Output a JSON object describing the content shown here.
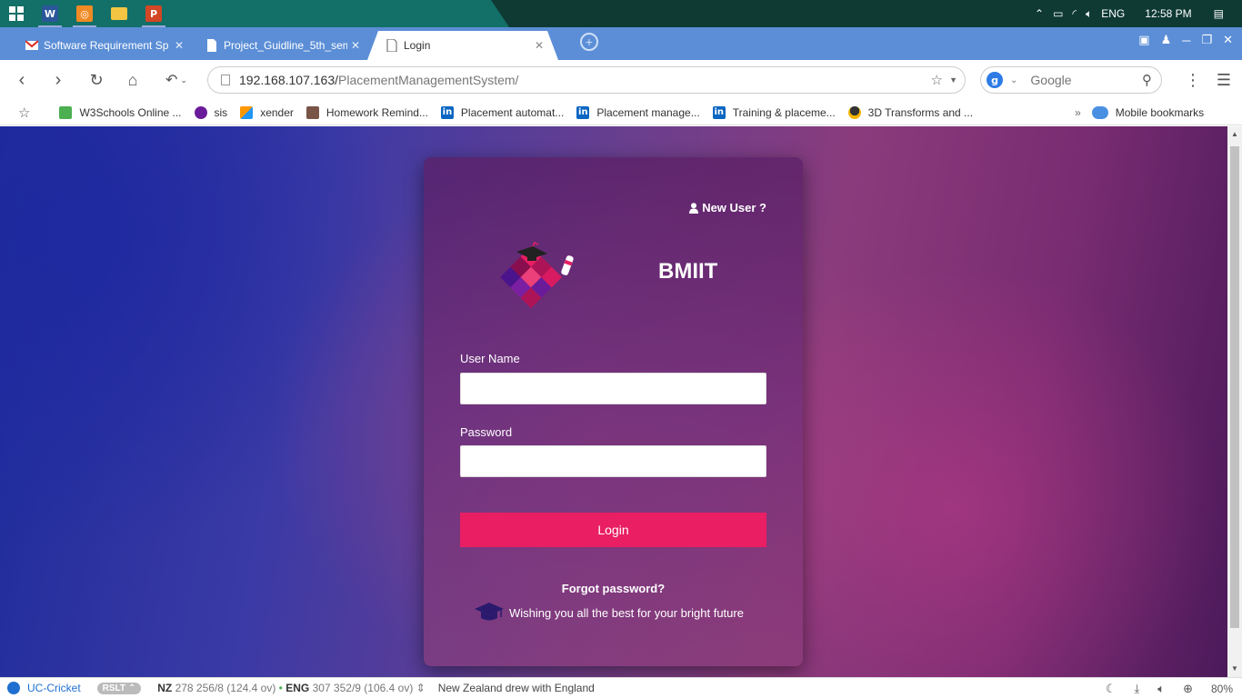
{
  "taskbar": {
    "apps": [
      {
        "icon": "windows-start-icon",
        "letter": ""
      },
      {
        "icon": "word-icon",
        "letter": "W",
        "color": "#2b579a"
      },
      {
        "icon": "uc-browser-icon",
        "letter": "",
        "color": "#f08a24"
      },
      {
        "icon": "file-explorer-icon",
        "letter": "",
        "color": "#f4c542"
      },
      {
        "icon": "powerpoint-icon",
        "letter": "P",
        "color": "#d24726"
      }
    ],
    "tray": {
      "language": "ENG",
      "time": "12:58 PM"
    }
  },
  "tabs": [
    {
      "title": "Software Requirement Sp",
      "favicon": "gmail-icon",
      "active": false
    },
    {
      "title": "Project_Guidline_5th_sem",
      "favicon": "document-icon",
      "active": false
    },
    {
      "title": "Login",
      "favicon": "document-icon",
      "active": true
    }
  ],
  "toolbar": {
    "url_host": "192.168.107.163/",
    "url_path": "PlacementManagementSystem/",
    "search_placeholder": "Google"
  },
  "bookmarks": [
    {
      "label": "W3Schools Online ...",
      "icon": "w3schools-icon",
      "color": "#4caf50"
    },
    {
      "label": "sis",
      "icon": "sis-icon",
      "color": "#6a1b9a"
    },
    {
      "label": "xender",
      "icon": "xender-icon",
      "color": "#ff9800"
    },
    {
      "label": "Homework Remind...",
      "icon": "homework-icon",
      "color": "#795548"
    },
    {
      "label": "Placement automat...",
      "icon": "linkedin-icon",
      "color": "#0a66c2"
    },
    {
      "label": "Placement manage...",
      "icon": "linkedin-icon",
      "color": "#0a66c2"
    },
    {
      "label": "Training & placeme...",
      "icon": "linkedin-icon",
      "color": "#0a66c2"
    },
    {
      "label": "3D Transforms and ...",
      "icon": "tux-icon",
      "color": "#333333"
    }
  ],
  "mobile_bookmarks": "Mobile bookmarks",
  "login": {
    "new_user": "New User ?",
    "brand": "BMIIT",
    "username_label": "User Name",
    "password_label": "Password",
    "login_button": "Login",
    "forgot": "Forgot password?",
    "wish": "Wishing you all the best for your bright future",
    "accent": "#e91e63"
  },
  "statusbar": {
    "app": "UC-Cricket",
    "badge": "RSLT",
    "team1": "NZ",
    "team1_score": "278 256/8 (124.4 ov)",
    "team2": "ENG",
    "team2_score": "307 352/9 (106.4 ov)",
    "result": "New Zealand drew with England",
    "zoom": "80%"
  }
}
